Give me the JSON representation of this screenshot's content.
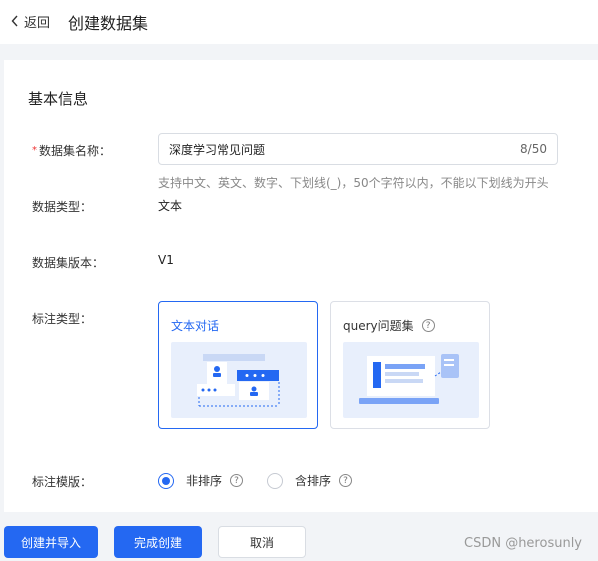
{
  "header": {
    "back_label": "返回",
    "title": "创建数据集"
  },
  "section_title": "基本信息",
  "form": {
    "name": {
      "label": "数据集名称：",
      "value": "深度学习常见问题",
      "counter": "8/50",
      "hint": "支持中文、英文、数字、下划线(_)，50个字符以内，不能以下划线为开头"
    },
    "type": {
      "label": "数据类型：",
      "value": "文本"
    },
    "version": {
      "label": "数据集版本：",
      "value": "V1"
    },
    "annotation_type": {
      "label": "标注类型：",
      "options": [
        {
          "label": "文本对话",
          "selected": true
        },
        {
          "label": "query问题集",
          "selected": false
        }
      ]
    },
    "template": {
      "label": "标注模版：",
      "options": [
        {
          "label": "非排序",
          "selected": true
        },
        {
          "label": "含排序",
          "selected": false
        }
      ]
    }
  },
  "footer": {
    "create_import": "创建并导入",
    "finish": "完成创建",
    "cancel": "取消"
  },
  "watermark": "CSDN @herosunly",
  "colors": {
    "primary": "#2468f2",
    "required": "#ee3333"
  }
}
